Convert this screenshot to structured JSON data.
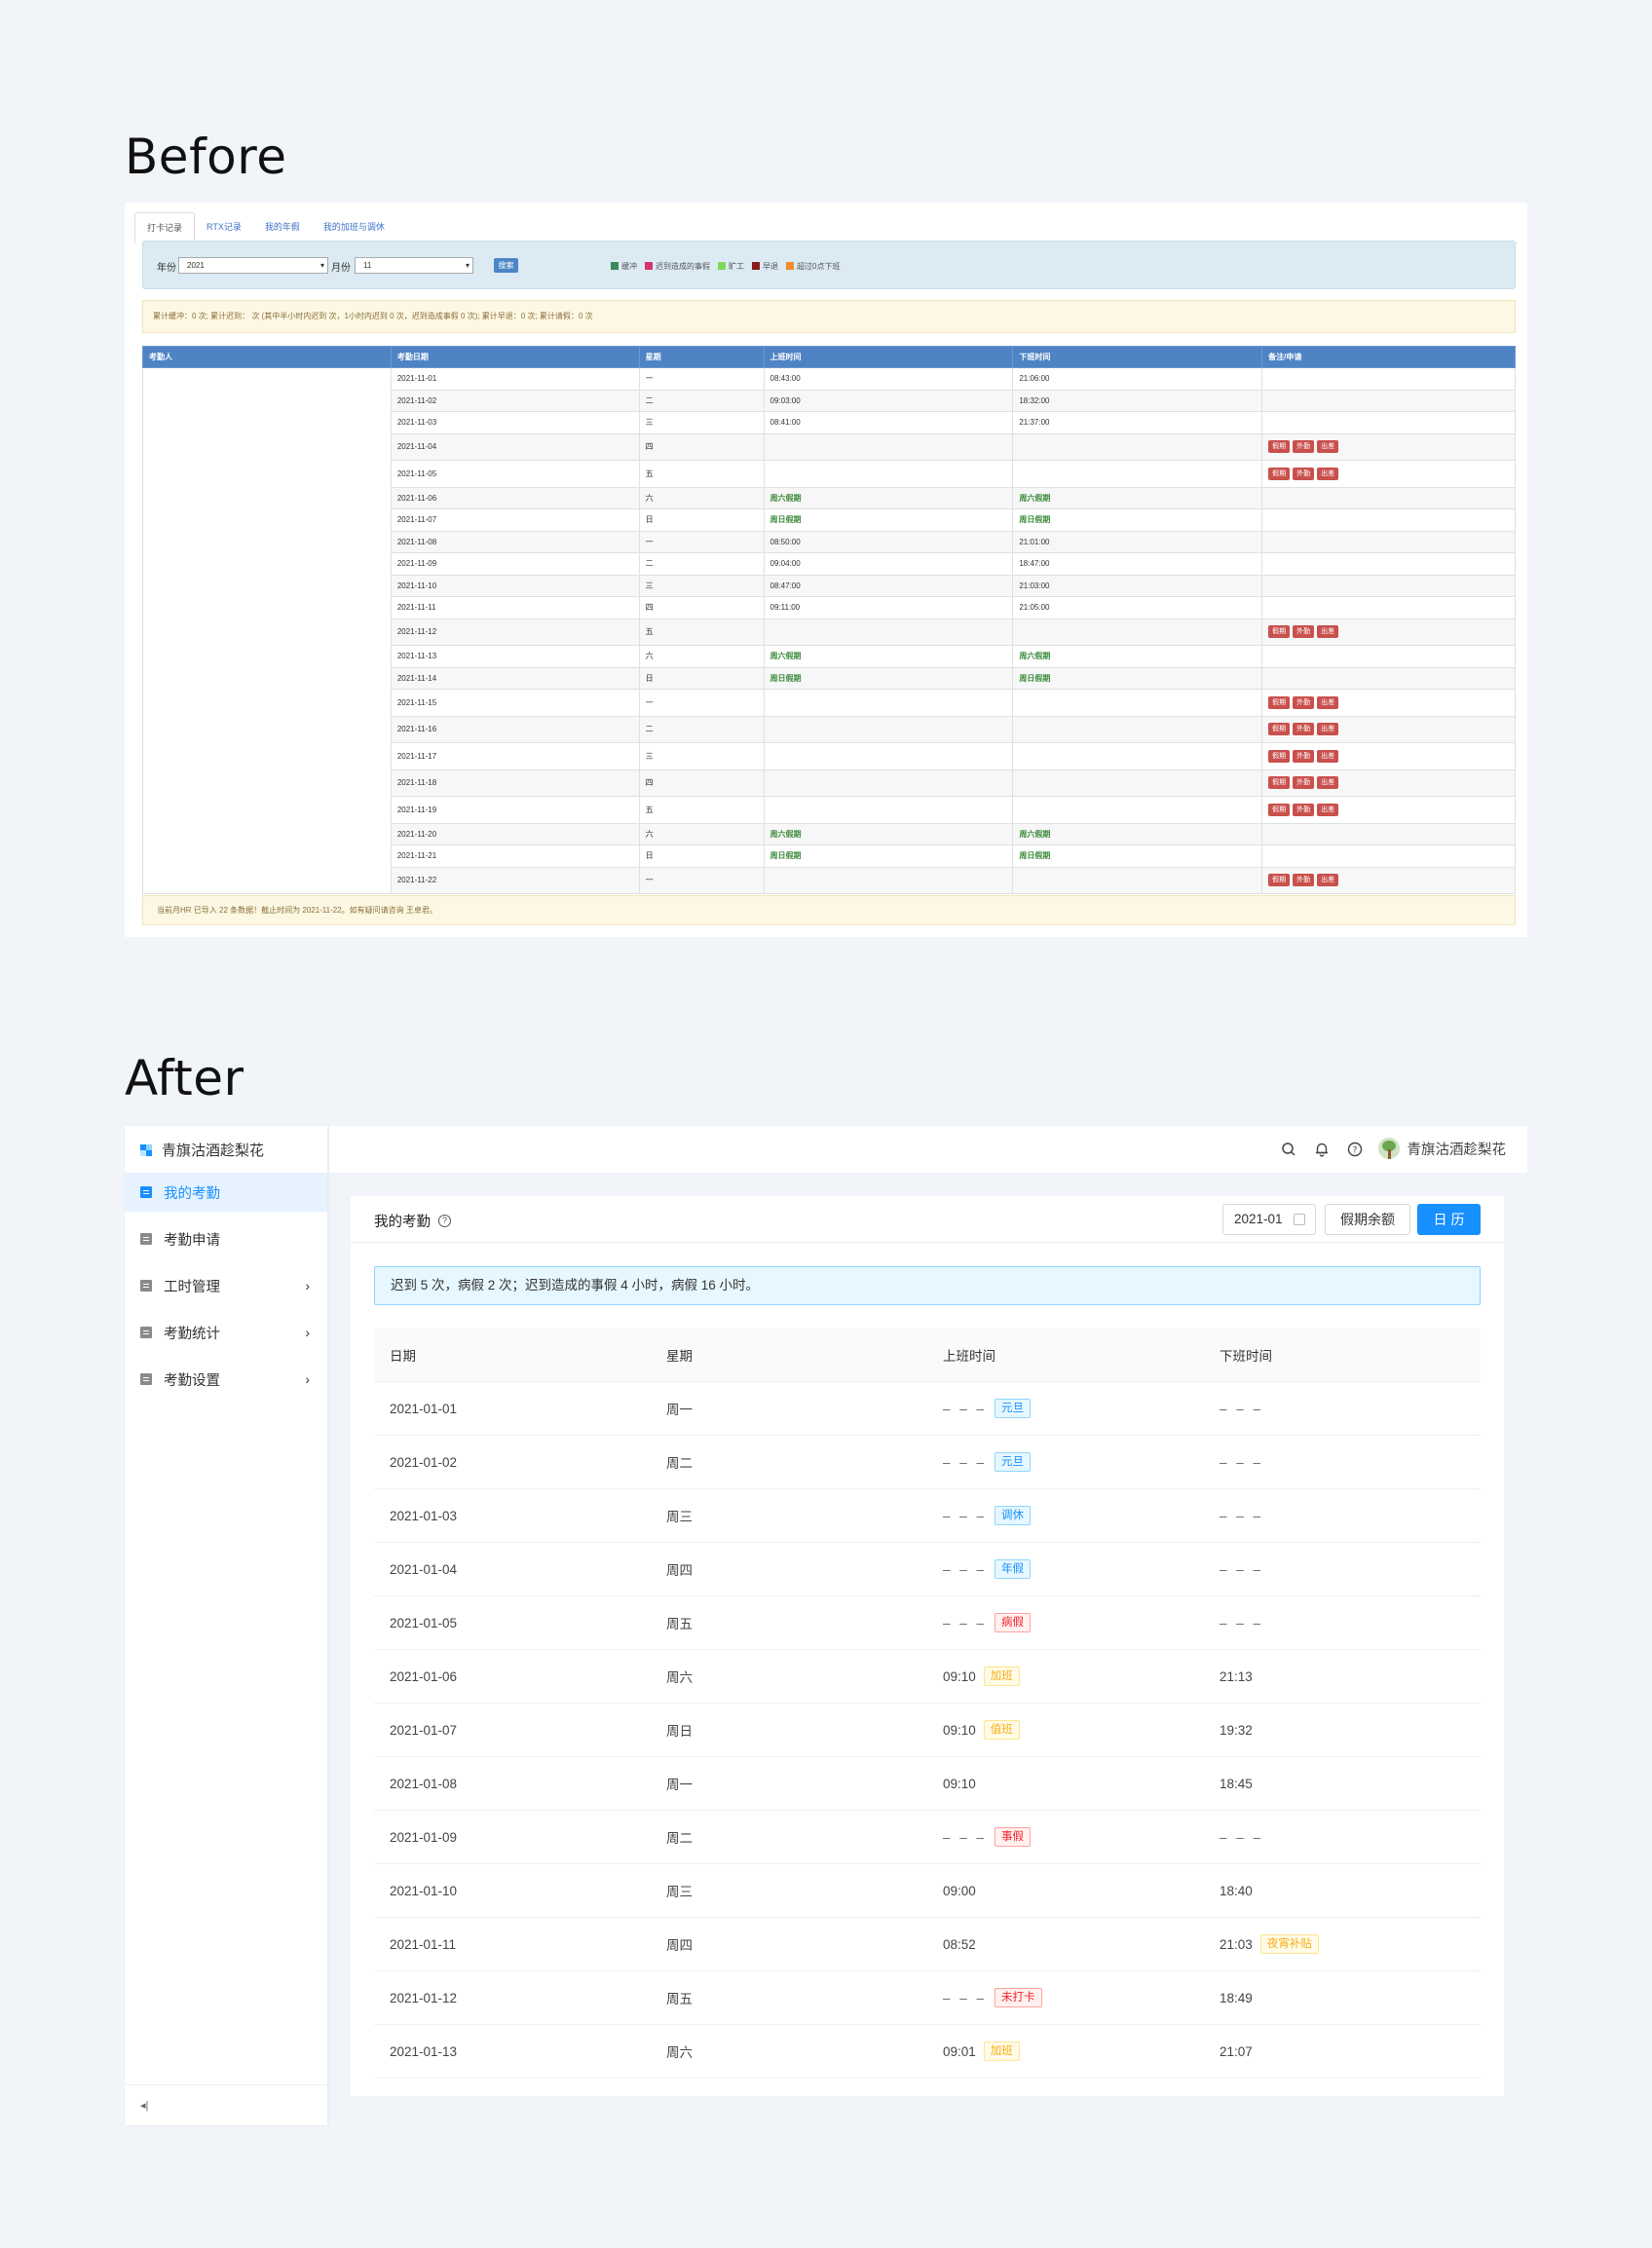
{
  "before": {
    "heading": "Before",
    "tabs": [
      "打卡记录",
      "RTX记录",
      "我的年假",
      "我的加班与调休"
    ],
    "filter": {
      "year_label": "年份",
      "year_value": "2021",
      "month_label": "月份",
      "month_value": "11",
      "search_label": "搜索"
    },
    "legend": [
      {
        "label": "缓冲",
        "color": "#3a8a5a"
      },
      {
        "label": "迟到造成的事假",
        "color": "#d6336c"
      },
      {
        "label": "旷工",
        "color": "#7ed957"
      },
      {
        "label": "早退",
        "color": "#8b1a1a"
      },
      {
        "label": "超过0点下班",
        "color": "#f08c2e"
      }
    ],
    "summary": "累计缓冲：0 次; 累计迟到：  次 (其中半小时内迟到  次，1小时内迟到 0 次，迟到造成事假 0 次); 累计早退：0 次; 累计请假：0 次",
    "columns": [
      "考勤人",
      "考勤日期",
      "星期",
      "上班时间",
      "下班时间",
      "备注/申请"
    ],
    "buttons": [
      "假期",
      "外勤",
      "出差"
    ],
    "rows": [
      {
        "date": "2021-11-01",
        "day": "一",
        "in": "08:43:00",
        "out": "21:06:00",
        "green": false,
        "btns": false
      },
      {
        "date": "2021-11-02",
        "day": "二",
        "in": "09:03:00",
        "out": "18:32:00",
        "green": false,
        "btns": false
      },
      {
        "date": "2021-11-03",
        "day": "三",
        "in": "08:41:00",
        "out": "21:37:00",
        "green": false,
        "btns": false
      },
      {
        "date": "2021-11-04",
        "day": "四",
        "in": "",
        "out": "",
        "green": false,
        "btns": true
      },
      {
        "date": "2021-11-05",
        "day": "五",
        "in": "",
        "out": "",
        "green": false,
        "btns": true
      },
      {
        "date": "2021-11-06",
        "day": "六",
        "in": "周六假期",
        "out": "周六假期",
        "green": true,
        "btns": false
      },
      {
        "date": "2021-11-07",
        "day": "日",
        "in": "周日假期",
        "out": "周日假期",
        "green": true,
        "btns": false
      },
      {
        "date": "2021-11-08",
        "day": "一",
        "in": "08:50:00",
        "out": "21:01:00",
        "green": false,
        "btns": false
      },
      {
        "date": "2021-11-09",
        "day": "二",
        "in": "09:04:00",
        "out": "18:47:00",
        "green": false,
        "btns": false
      },
      {
        "date": "2021-11-10",
        "day": "三",
        "in": "08:47:00",
        "out": "21:03:00",
        "green": false,
        "btns": false
      },
      {
        "date": "2021-11-11",
        "day": "四",
        "in": "09:11:00",
        "out": "21:05:00",
        "green": false,
        "btns": false
      },
      {
        "date": "2021-11-12",
        "day": "五",
        "in": "",
        "out": "",
        "green": false,
        "btns": true
      },
      {
        "date": "2021-11-13",
        "day": "六",
        "in": "周六假期",
        "out": "周六假期",
        "green": true,
        "btns": false
      },
      {
        "date": "2021-11-14",
        "day": "日",
        "in": "周日假期",
        "out": "周日假期",
        "green": true,
        "btns": false
      },
      {
        "date": "2021-11-15",
        "day": "一",
        "in": "",
        "out": "",
        "green": false,
        "btns": true
      },
      {
        "date": "2021-11-16",
        "day": "二",
        "in": "",
        "out": "",
        "green": false,
        "btns": true
      },
      {
        "date": "2021-11-17",
        "day": "三",
        "in": "",
        "out": "",
        "green": false,
        "btns": true
      },
      {
        "date": "2021-11-18",
        "day": "四",
        "in": "",
        "out": "",
        "green": false,
        "btns": true
      },
      {
        "date": "2021-11-19",
        "day": "五",
        "in": "",
        "out": "",
        "green": false,
        "btns": true
      },
      {
        "date": "2021-11-20",
        "day": "六",
        "in": "周六假期",
        "out": "周六假期",
        "green": true,
        "btns": false
      },
      {
        "date": "2021-11-21",
        "day": "日",
        "in": "周日假期",
        "out": "周日假期",
        "green": true,
        "btns": false
      },
      {
        "date": "2021-11-22",
        "day": "一",
        "in": "",
        "out": "",
        "green": false,
        "btns": true
      }
    ],
    "footer": "当前月HR 已导入 22 条数据！截止时间为 2021-11-22。如有疑问请咨询 王卓君。"
  },
  "after": {
    "heading": "After",
    "brand": "青旗沽酒趁梨花",
    "nav": [
      {
        "label": "我的考勤",
        "active": true,
        "arrow": false
      },
      {
        "label": "考勤申请",
        "active": false,
        "arrow": false
      },
      {
        "label": "工时管理",
        "active": false,
        "arrow": true
      },
      {
        "label": "考勤统计",
        "active": false,
        "arrow": true
      },
      {
        "label": "考勤设置",
        "active": false,
        "arrow": true
      }
    ],
    "collapse_icon": "collapse-icon",
    "user_name": "青旗沽酒趁梨花",
    "card_title": "我的考勤",
    "date_value": "2021-01",
    "balance_button": "假期余额",
    "calendar_button": "日历",
    "alert": "迟到 5 次，病假 2 次；迟到造成的事假 4 小时，病假 16 小时。",
    "columns": [
      "日期",
      "星期",
      "上班时间",
      "下班时间"
    ],
    "rows": [
      {
        "date": "2021-01-01",
        "day": "周一",
        "in": "– – –",
        "in_tag": "元旦",
        "in_tag_color": "blue",
        "out": "– – –",
        "out_tag": "",
        "out_tag_color": ""
      },
      {
        "date": "2021-01-02",
        "day": "周二",
        "in": "– – –",
        "in_tag": "元旦",
        "in_tag_color": "blue",
        "out": "– – –",
        "out_tag": "",
        "out_tag_color": ""
      },
      {
        "date": "2021-01-03",
        "day": "周三",
        "in": "– – –",
        "in_tag": "调休",
        "in_tag_color": "blue",
        "out": "– – –",
        "out_tag": "",
        "out_tag_color": ""
      },
      {
        "date": "2021-01-04",
        "day": "周四",
        "in": "– – –",
        "in_tag": "年假",
        "in_tag_color": "blue",
        "out": "– – –",
        "out_tag": "",
        "out_tag_color": ""
      },
      {
        "date": "2021-01-05",
        "day": "周五",
        "in": "– – –",
        "in_tag": "病假",
        "in_tag_color": "red",
        "out": "– – –",
        "out_tag": "",
        "out_tag_color": ""
      },
      {
        "date": "2021-01-06",
        "day": "周六",
        "in": "09:10",
        "in_tag": "加班",
        "in_tag_color": "gold",
        "out": "21:13",
        "out_tag": "",
        "out_tag_color": ""
      },
      {
        "date": "2021-01-07",
        "day": "周日",
        "in": "09:10",
        "in_tag": "值班",
        "in_tag_color": "gold",
        "out": "19:32",
        "out_tag": "",
        "out_tag_color": ""
      },
      {
        "date": "2021-01-08",
        "day": "周一",
        "in": "09:10",
        "in_tag": "",
        "in_tag_color": "",
        "out": "18:45",
        "out_tag": "",
        "out_tag_color": ""
      },
      {
        "date": "2021-01-09",
        "day": "周二",
        "in": "– – –",
        "in_tag": "事假",
        "in_tag_color": "red",
        "out": "– – –",
        "out_tag": "",
        "out_tag_color": ""
      },
      {
        "date": "2021-01-10",
        "day": "周三",
        "in": "09:00",
        "in_tag": "",
        "in_tag_color": "",
        "out": "18:40",
        "out_tag": "",
        "out_tag_color": ""
      },
      {
        "date": "2021-01-11",
        "day": "周四",
        "in": "08:52",
        "in_tag": "",
        "in_tag_color": "",
        "out": "21:03",
        "out_tag": "夜宵补贴",
        "out_tag_color": "gold"
      },
      {
        "date": "2021-01-12",
        "day": "周五",
        "in": "– – –",
        "in_tag": "未打卡",
        "in_tag_color": "red",
        "out": "18:49",
        "out_tag": "",
        "out_tag_color": ""
      },
      {
        "date": "2021-01-13",
        "day": "周六",
        "in": "09:01",
        "in_tag": "加班",
        "in_tag_color": "gold",
        "out": "21:07",
        "out_tag": "",
        "out_tag_color": ""
      }
    ]
  }
}
